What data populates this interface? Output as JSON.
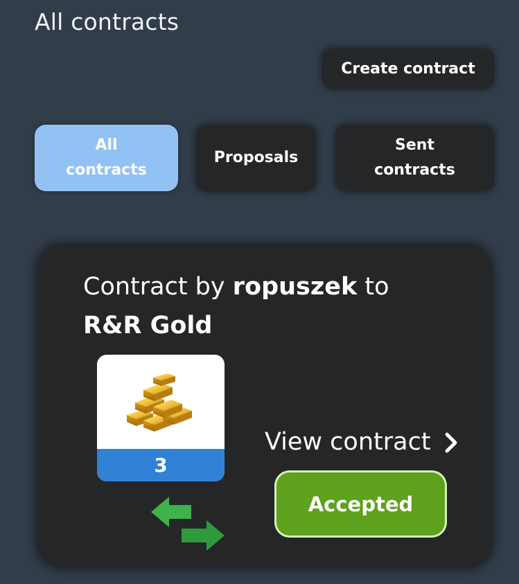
{
  "header": {
    "title": "All contracts",
    "create_label": "Create contract"
  },
  "tabs": [
    {
      "label_line1": "All",
      "label_line2": "contracts",
      "active": true
    },
    {
      "label_line1": "Proposals",
      "label_line2": "",
      "active": false
    },
    {
      "label_line1": "Sent",
      "label_line2": "contracts",
      "active": false
    }
  ],
  "contract": {
    "prefix": "Contract by",
    "author": "ropuszek",
    "connector": "to",
    "recipient": "R&R Gold",
    "item": {
      "icon": "gold-bars-icon",
      "quantity": "3"
    },
    "swap_icon": "swap-arrows-icon",
    "view_label": "View contract",
    "status": "Accepted"
  },
  "colors": {
    "background": "#323d4a",
    "card": "#252628",
    "active_tab": "#92c1f3",
    "quantity_bar": "#2f82d6",
    "accepted": "#5ea11c",
    "swap_arrow": "#3fb24a"
  }
}
